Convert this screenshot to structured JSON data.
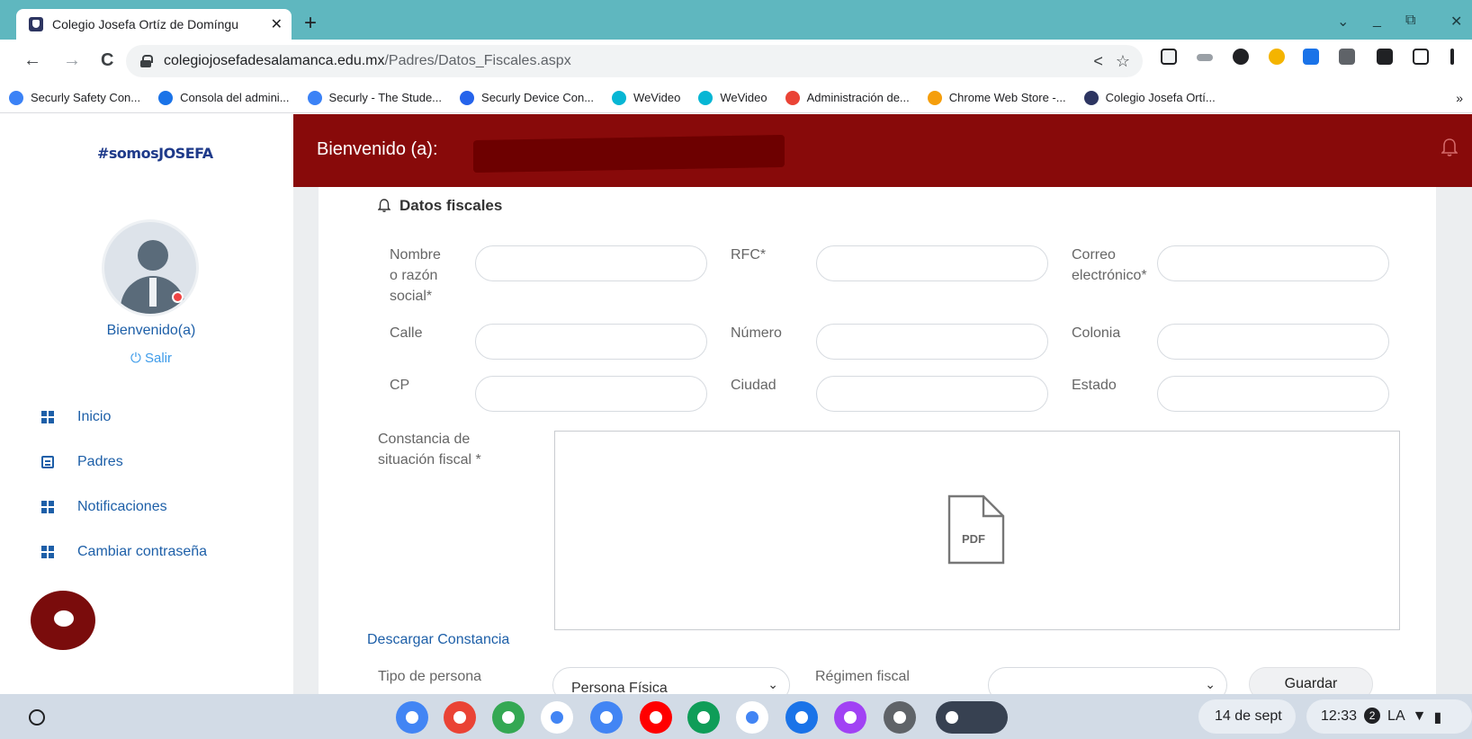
{
  "browser": {
    "tab_title": "Colegio Josefa Ortíz de Domíngu",
    "tab_close": "✕",
    "new_tab": "+",
    "url_host": "colegiojosefadesalamanca.edu.mx",
    "url_path": "/Padres/Datos_Fiscales.aspx",
    "nav": {
      "back": "←",
      "forward": "→",
      "reload": "C"
    },
    "window": {
      "dropdown": "⌄",
      "minimize": "_",
      "restore": "⧉",
      "close": "✕"
    },
    "bookmarks": [
      {
        "label": "Securly Safety Con...",
        "color": "#3b82f6"
      },
      {
        "label": "Consola del admini...",
        "color": "#1a73e8"
      },
      {
        "label": "Securly - The Stude...",
        "color": "#3b82f6"
      },
      {
        "label": "Securly Device Con...",
        "color": "#2563eb"
      },
      {
        "label": "WeVideo",
        "color": "#06b6d4"
      },
      {
        "label": "WeVideo",
        "color": "#06b6d4"
      },
      {
        "label": "Administración de...",
        "color": "#ea4335"
      },
      {
        "label": "Chrome Web Store -...",
        "color": "#f59e0b"
      },
      {
        "label": "Colegio Josefa Ortí...",
        "color": "#2d3561"
      }
    ],
    "bookmarks_more": "»"
  },
  "sidebar": {
    "logo": "#somosJOSEFA",
    "welcome": "Bienvenido(a)",
    "logout": "⏻ Salir",
    "menu": [
      {
        "label": "Inicio",
        "icon": "dashboard-icon"
      },
      {
        "label": "Padres",
        "icon": "book-icon"
      },
      {
        "label": "Notificaciones",
        "icon": "dashboard-icon"
      },
      {
        "label": "Cambiar contraseña",
        "icon": "dashboard-icon"
      }
    ]
  },
  "header": {
    "greeting": "Bienvenido (a):"
  },
  "form": {
    "section_title": "Datos fiscales",
    "labels": {
      "nombre": "Nombre\no razón\nsocial*",
      "rfc": "RFC*",
      "correo": "Correo\nelectrónico*",
      "calle": "Calle",
      "numero": "Número",
      "colonia": "Colonia",
      "cp": "CP",
      "ciudad": "Ciudad",
      "estado": "Estado",
      "constancia": "Constancia de\nsituación fiscal *",
      "tipo_persona": "Tipo de persona",
      "regimen": "Régimen fiscal"
    },
    "pdf_label": "PDF",
    "download_link": "Descargar Constancia",
    "tipo_persona_value": "Persona Física",
    "regimen_value": "",
    "save_button": "Guardar"
  },
  "shelf": {
    "date": "14 de sept",
    "time": "12:33",
    "notif_count": "2",
    "locale": "LA",
    "apps": [
      "#4285f4",
      "#ea4335",
      "#34a853",
      "#ffffff",
      "#4285f4",
      "#ff0000",
      "#0f9d58",
      "#ffffff",
      "#1a73e8",
      "#a142f4",
      "#5f6368",
      "#374151"
    ]
  },
  "colors": {
    "brand_red": "#880a0a",
    "link_blue": "#1d5fa8"
  }
}
